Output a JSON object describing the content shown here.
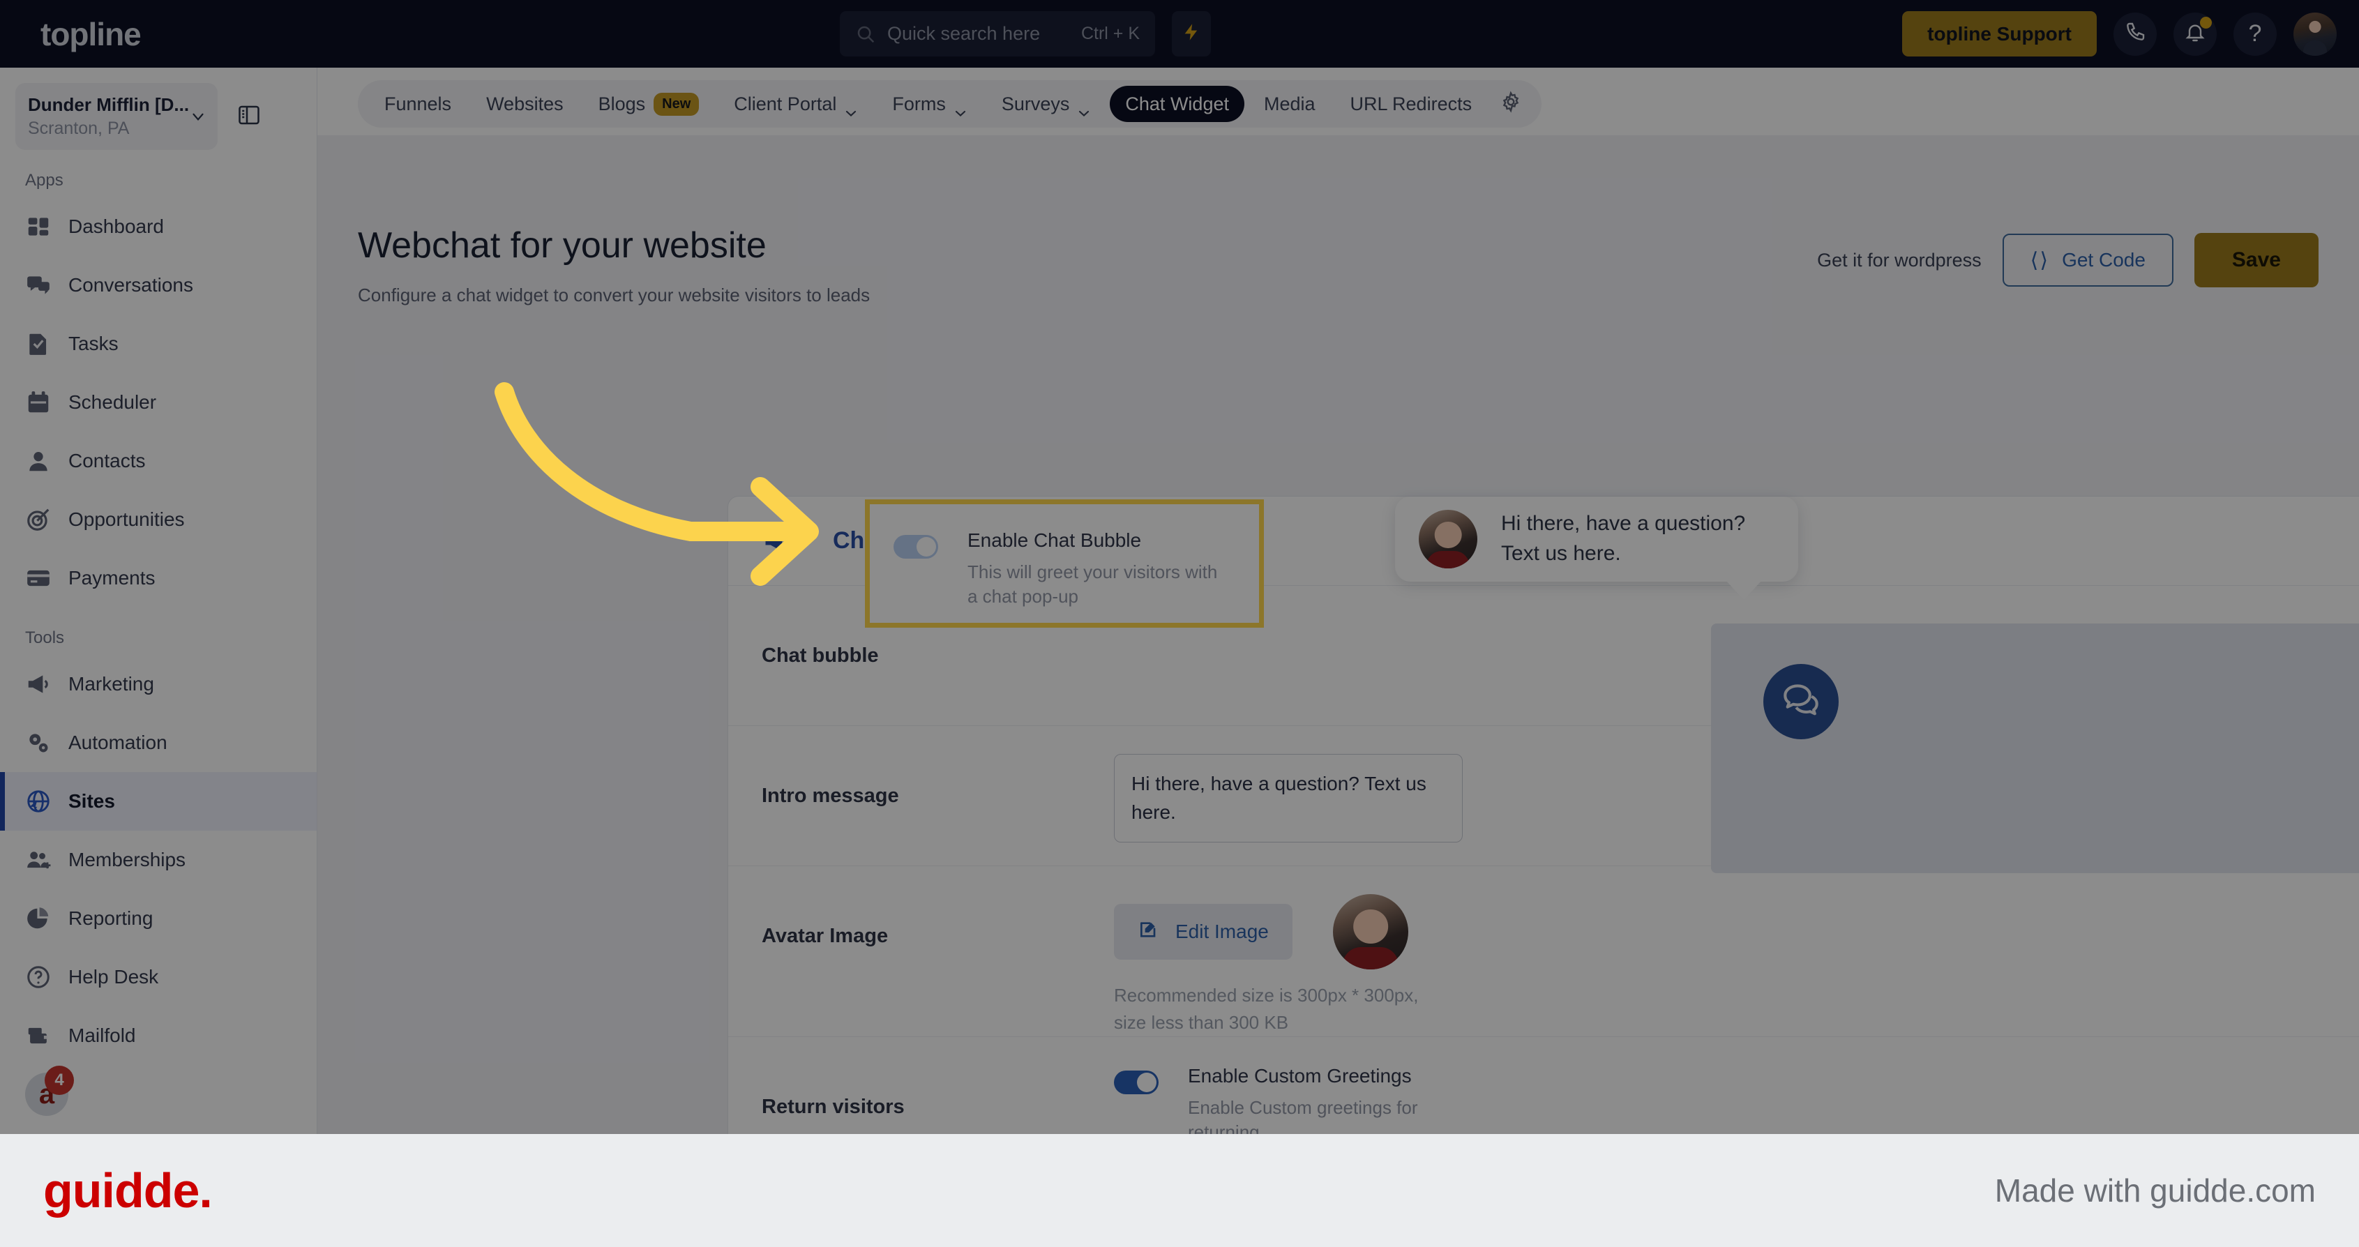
{
  "topbar": {
    "brand": "topline",
    "search": {
      "placeholder": "Quick search here",
      "shortcut": "Ctrl + K",
      "icon": "search-icon"
    },
    "bolt_icon": "lightning-bolt-icon",
    "support_button": "topline Support",
    "phone_icon": "phone-icon",
    "bell_icon": "bell-icon",
    "help_icon": "question-mark-icon",
    "avatar": "user-avatar"
  },
  "sidebar": {
    "location": {
      "name": "Dunder Mifflin [D...",
      "sub": "Scranton, PA",
      "chevron": "chevron-down-icon"
    },
    "panel_toggle_icon": "panel-collapse-icon",
    "sections": [
      {
        "label": "Apps",
        "items": [
          {
            "label": "Dashboard",
            "icon": "dashboard-icon",
            "active": false
          },
          {
            "label": "Conversations",
            "icon": "chat-icon",
            "active": false
          },
          {
            "label": "Tasks",
            "icon": "task-icon",
            "active": false
          },
          {
            "label": "Scheduler",
            "icon": "calendar-icon",
            "active": false
          },
          {
            "label": "Contacts",
            "icon": "person-icon",
            "active": false
          },
          {
            "label": "Opportunities",
            "icon": "target-icon",
            "active": false
          },
          {
            "label": "Payments",
            "icon": "credit-card-icon",
            "active": false
          }
        ]
      },
      {
        "label": "Tools",
        "items": [
          {
            "label": "Marketing",
            "icon": "megaphone-icon",
            "active": false
          },
          {
            "label": "Automation",
            "icon": "gears-icon",
            "active": false
          },
          {
            "label": "Sites",
            "icon": "globe-cursor-icon",
            "active": true
          },
          {
            "label": "Memberships",
            "icon": "people-add-icon",
            "active": false
          },
          {
            "label": "Reporting",
            "icon": "pie-chart-icon",
            "active": false
          },
          {
            "label": "Help Desk",
            "icon": "question-circle-icon",
            "active": false
          },
          {
            "label": "Mailfold",
            "icon": "mail-stack-icon",
            "active": false
          }
        ]
      }
    ],
    "bottom_badge_count": "4"
  },
  "subnav": {
    "tabs": [
      {
        "label": "Funnels",
        "caret": false,
        "badge": null,
        "selected": false
      },
      {
        "label": "Websites",
        "caret": false,
        "badge": null,
        "selected": false
      },
      {
        "label": "Blogs",
        "caret": false,
        "badge": "New",
        "selected": false
      },
      {
        "label": "Client Portal",
        "caret": true,
        "badge": null,
        "selected": false
      },
      {
        "label": "Forms",
        "caret": true,
        "badge": null,
        "selected": false
      },
      {
        "label": "Surveys",
        "caret": true,
        "badge": null,
        "selected": false
      },
      {
        "label": "Chat Widget",
        "caret": false,
        "badge": null,
        "selected": true
      },
      {
        "label": "Media",
        "caret": false,
        "badge": null,
        "selected": false
      },
      {
        "label": "URL Redirects",
        "caret": false,
        "badge": null,
        "selected": false
      }
    ],
    "settings_icon": "gear-icon"
  },
  "page": {
    "title": "Webchat for your website",
    "subtitle": "Configure a chat widget to convert your website visitors to leads",
    "wordpress_text": "Get it for wordpress",
    "get_code_label": "Get Code",
    "get_code_icon": "code-brackets-icon",
    "save_label": "Save"
  },
  "card": {
    "icon": "megaphone-icon",
    "title": "Chat bubble",
    "collapse_icon": "chevron-down-icon",
    "rows": [
      {
        "label": "Chat bubble",
        "toggle_state": "on-light",
        "toggle_title": "Enable Chat Bubble",
        "toggle_desc": "This will greet your visitors with a chat pop-up"
      },
      {
        "label": "Intro message",
        "value": "Hi there, have a question? Text us here."
      },
      {
        "label": "Avatar Image",
        "edit_label": "Edit Image",
        "edit_icon": "edit-pencil-icon",
        "hint": "Recommended size is 300px * 300px, size less than 300 KB"
      },
      {
        "label": "Return visitors",
        "toggle_state": "on-solid",
        "toggle_title": "Enable Custom Greetings",
        "toggle_desc": "Enable Custom greetings for returning"
      }
    ]
  },
  "preview": {
    "message": "Hi there, have a question? Text us here.",
    "avatar": "agent-avatar",
    "fab_icon": "chat-bubbles-icon"
  },
  "footer": {
    "logo": "guidde.",
    "made_with": "Made with guidde.com"
  },
  "colors": {
    "topbar_bg": "#0b0f24",
    "accent_gold": "#9c7a1d",
    "accent_blue": "#2a4fa6",
    "highlight_yellow": "#ffd84d",
    "guidde_red": "#cc0000",
    "sidebar_active_blue": "#2246a8"
  }
}
